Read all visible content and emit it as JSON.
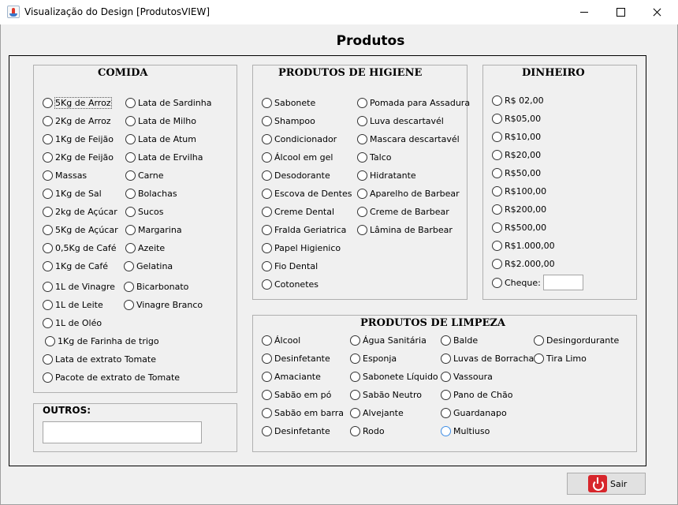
{
  "window": {
    "title": "Visualização do Design [ProdutosVIEW]"
  },
  "page": {
    "title": "Produtos"
  },
  "comida": {
    "title": "COMIDA",
    "col1": [
      "5Kg de Arroz",
      "2Kg de Arroz",
      "1Kg de Feijão",
      "2Kg de Feijão",
      "Massas",
      "1Kg de Sal",
      "2kg de Açúcar",
      "5Kg de Açúcar",
      "0,5Kg de Café",
      "1Kg de Café",
      "1L de Vinagre",
      "1L de Leite",
      "1L de Oléo",
      "1Kg de Farinha de trigo",
      "Lata de extrato Tomate",
      "Pacote de extrato de Tomate"
    ],
    "col2": [
      "Lata de Sardinha",
      "Lata de Milho",
      "Lata de Atum",
      "Lata de Ervilha",
      "Carne",
      "Bolachas",
      "Sucos",
      "Margarina",
      "Azeite",
      "Gelatina",
      "Bicarbonato",
      "Vinagre Branco"
    ]
  },
  "higiene": {
    "title": "PRODUTOS DE HIGIENE",
    "col1": [
      "Sabonete",
      "Shampoo",
      "Condicionador",
      "Álcool em gel",
      "Desodorante",
      "Escova de Dentes",
      "Creme Dental",
      "Fralda Geriatrica",
      "Papel Higienico",
      "Fio Dental",
      "Cotonetes"
    ],
    "col2": [
      "Pomada para Assadura",
      "Luva descartavél",
      "Mascara descartavél",
      "Talco",
      "Hidratante",
      "Aparelho de Barbear",
      "Creme de Barbear",
      "Lâmina de Barbear"
    ]
  },
  "dinheiro": {
    "title": "DINHEIRO",
    "items": [
      "R$ 02,00",
      "R$05,00",
      "R$10,00",
      "R$20,00",
      "R$50,00",
      "R$100,00",
      "R$200,00",
      "R$500,00",
      "R$1.000,00",
      "R$2.000,00",
      "Cheque:"
    ],
    "cheque_value": ""
  },
  "limpeza": {
    "title": "PRODUTOS DE LIMPEZA",
    "col1": [
      "Álcool",
      "Desinfetante",
      "Amaciante",
      "Sabão em pó",
      "Sabão em barra",
      "Desinfetante"
    ],
    "col2": [
      "Água Sanitária",
      "Esponja",
      "Sabonete Líquido",
      "Sabão Neutro",
      "Alvejante",
      "Rodo"
    ],
    "col3": [
      "Balde",
      "Luvas de Borracha",
      "Vassoura",
      "Pano de Chão",
      "Guardanapo",
      "Multiuso"
    ],
    "col4": [
      "Desingordurante",
      "Tira Limo"
    ]
  },
  "outros": {
    "title": "OUTROS:",
    "value": ""
  },
  "sair": {
    "label": "Sair"
  }
}
